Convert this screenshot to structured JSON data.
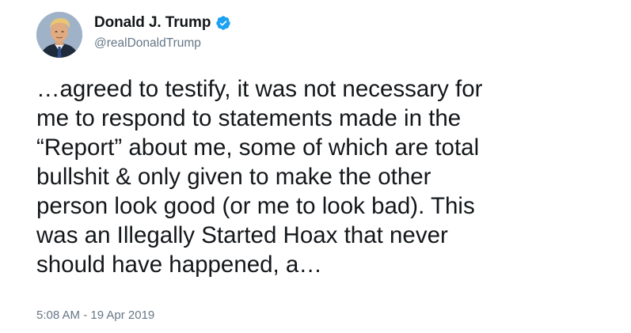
{
  "author": {
    "display_name": "Donald J. Trump",
    "handle": "@realDonaldTrump",
    "verified": true
  },
  "tweet": {
    "text": "…agreed to testify, it was not necessary for\nme to respond to statements made in the\n“Report” about me, some of which are total\nbullshit & only given to make the other\nperson look good (or me to look bad). This\nwas an Illegally Started Hoax that never\nshould have happened, a…",
    "timestamp": "5:08 AM - 19 Apr 2019"
  },
  "icons": {
    "avatar": "profile-photo",
    "verified": "verified-badge-icon"
  },
  "colors": {
    "text": "#14171a",
    "secondary": "#657786",
    "verified_blue": "#1da1f2",
    "background": "#ffffff"
  }
}
